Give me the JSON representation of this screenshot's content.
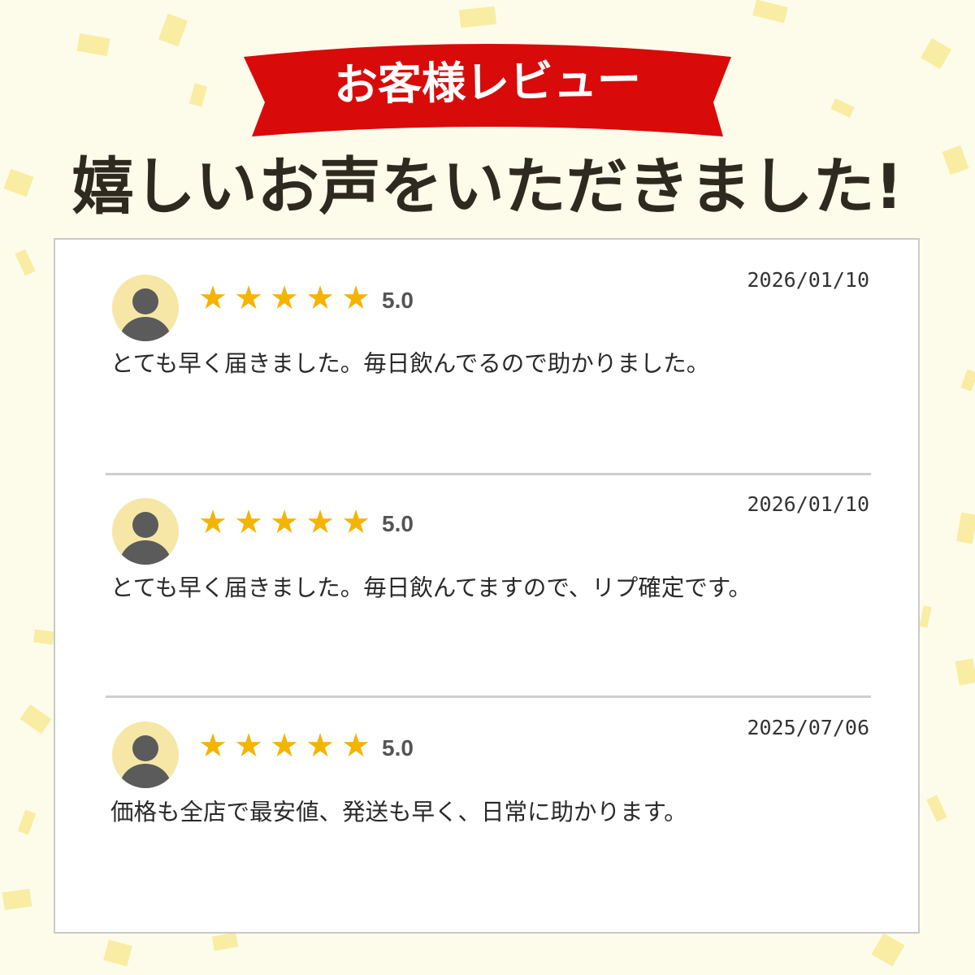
{
  "banner": {
    "label": "お客様レビュー"
  },
  "headline": "嬉しいお声をいただきました!",
  "colors": {
    "background": "#fdfceb",
    "banner_red": "#d90a0a",
    "star": "#f4b400",
    "avatar_bg": "#f6e7a7",
    "avatar_figure": "#5b5b5b",
    "confetti": "#f5e88a"
  },
  "icons": {
    "avatar": "user-avatar-icon",
    "star": "star-icon"
  },
  "reviews": [
    {
      "stars": 5,
      "rating": "5.0",
      "date": "2026/01/10",
      "comment": "とても早く届きました。毎日飲んでるので助かりました。"
    },
    {
      "stars": 5,
      "rating": "5.0",
      "date": "2026/01/10",
      "comment": "とても早く届きました。毎日飲んてますので、リプ確定です。"
    },
    {
      "stars": 5,
      "rating": "5.0",
      "date": "2025/07/06",
      "comment": "価格も全店で最安値、発送も早く、日常に助かります。"
    }
  ]
}
